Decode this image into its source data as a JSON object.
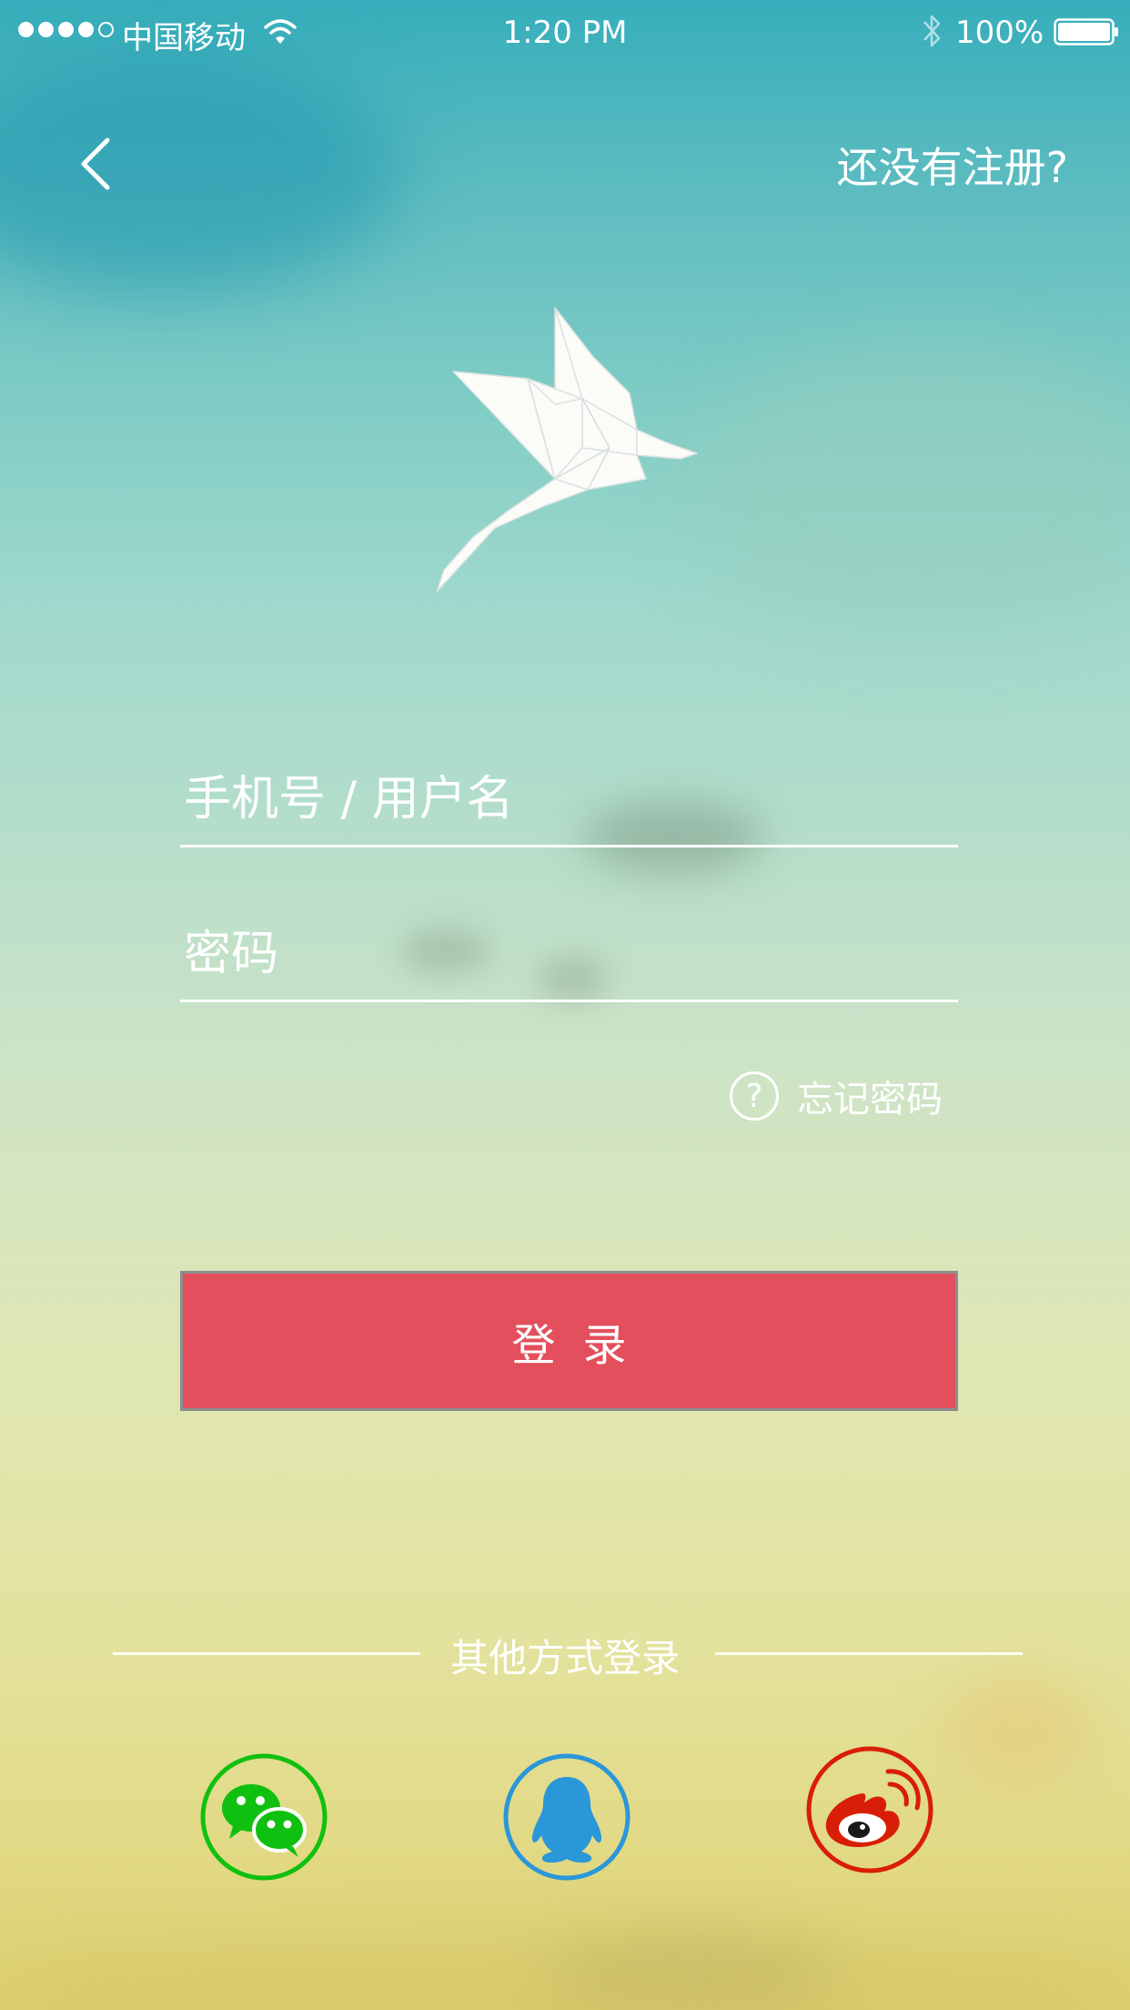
{
  "status_bar": {
    "carrier": "中国移动",
    "time": "1:20 PM",
    "battery": "100%"
  },
  "nav": {
    "register_link": "还没有注册?"
  },
  "form": {
    "username_placeholder": "手机号 / 用户名",
    "password_placeholder": "密码",
    "forgot_password": "忘记密码",
    "forgot_icon_glyph": "?",
    "login_button": "登录"
  },
  "other_login": {
    "label": "其他方式登录",
    "options": [
      "wechat-icon",
      "qq-icon",
      "weibo-icon"
    ]
  },
  "colors": {
    "login_button": "#e34f5d",
    "wechat": "#10c010",
    "qq": "#2a97d8",
    "weibo": "#d81e06"
  }
}
